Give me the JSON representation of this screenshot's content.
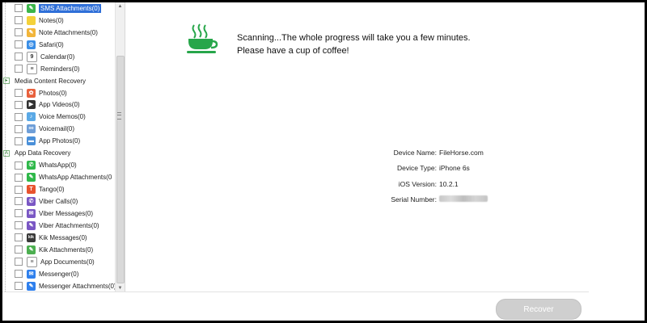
{
  "sidebar": {
    "rows": [
      {
        "type": "item",
        "label": "SMS Attachments(0)",
        "icon": "sms-attachment-icon",
        "color": "#3bb54a",
        "glyph": "✎",
        "selected": true
      },
      {
        "type": "item",
        "label": "Notes(0)",
        "icon": "notes-icon",
        "color": "#f4d13a",
        "glyph": ""
      },
      {
        "type": "item",
        "label": "Note Attachments(0)",
        "icon": "note-attachment-icon",
        "color": "#f2b53a",
        "glyph": "✎"
      },
      {
        "type": "item",
        "label": "Safari(0)",
        "icon": "safari-icon",
        "color": "#3a8ee6",
        "glyph": "◎"
      },
      {
        "type": "item",
        "label": "Calendar(0)",
        "icon": "calendar-icon",
        "color": "#ffffff",
        "glyph": "9",
        "fg": "#333",
        "border": "#999"
      },
      {
        "type": "item",
        "label": "Reminders(0)",
        "icon": "reminders-icon",
        "color": "#ffffff",
        "glyph": "≡",
        "fg": "#333",
        "border": "#999"
      },
      {
        "type": "group",
        "label": "Media Content Recovery",
        "icon": "media-expander-icon"
      },
      {
        "type": "item",
        "label": "Photos(0)",
        "icon": "photos-icon",
        "color": "#e8603c",
        "glyph": "✿"
      },
      {
        "type": "item",
        "label": "App Videos(0)",
        "icon": "video-icon",
        "color": "#333333",
        "glyph": "▶"
      },
      {
        "type": "item",
        "label": "Voice Memos(0)",
        "icon": "voice-memo-icon",
        "color": "#5aa9e6",
        "glyph": "♪"
      },
      {
        "type": "item",
        "label": "Voicemail(0)",
        "icon": "voicemail-icon",
        "color": "#6f9fd8",
        "glyph": "oo"
      },
      {
        "type": "item",
        "label": "App Photos(0)",
        "icon": "app-photos-icon",
        "color": "#4a90d9",
        "glyph": "▬"
      },
      {
        "type": "group",
        "label": "App Data Recovery",
        "icon": "app-data-expander-icon"
      },
      {
        "type": "item",
        "label": "WhatsApp(0)",
        "icon": "whatsapp-icon",
        "color": "#2fb84a",
        "glyph": "✆"
      },
      {
        "type": "item",
        "label": "WhatsApp Attachments(0",
        "icon": "whatsapp-attachment-icon",
        "color": "#2fb84a",
        "glyph": "✎"
      },
      {
        "type": "item",
        "label": "Tango(0)",
        "icon": "tango-icon",
        "color": "#e8532e",
        "glyph": "T"
      },
      {
        "type": "item",
        "label": "Viber Calls(0)",
        "icon": "viber-icon",
        "color": "#7a57c4",
        "glyph": "✆"
      },
      {
        "type": "item",
        "label": "Viber Messages(0)",
        "icon": "viber-message-icon",
        "color": "#7a57c4",
        "glyph": "✉"
      },
      {
        "type": "item",
        "label": "Viber Attachments(0)",
        "icon": "viber-attachment-icon",
        "color": "#7a57c4",
        "glyph": "✎"
      },
      {
        "type": "item",
        "label": "Kik Messages(0)",
        "icon": "kik-icon",
        "color": "#3a3a3a",
        "glyph": "kik"
      },
      {
        "type": "item",
        "label": "Kik Attachments(0)",
        "icon": "kik-attachment-icon",
        "color": "#4caf50",
        "glyph": "✎"
      },
      {
        "type": "item",
        "label": "App Documents(0)",
        "icon": "document-icon",
        "color": "#ffffff",
        "glyph": "≡",
        "fg": "#555",
        "border": "#999"
      },
      {
        "type": "item",
        "label": "Messenger(0)",
        "icon": "messenger-icon",
        "color": "#2f80ed",
        "glyph": "✉"
      },
      {
        "type": "item",
        "label": "Messenger Attachments(0)",
        "icon": "messenger-attachment-icon",
        "color": "#2f80ed",
        "glyph": "✎"
      }
    ]
  },
  "main": {
    "icon": "coffee-cup-icon",
    "accent": "#27a64a",
    "scan_line1": "Scanning...The whole progress will take you a few minutes.",
    "scan_line2": "Please have a cup of coffee!",
    "device": {
      "name_label": "Device Name:",
      "name_value": "FileHorse.com",
      "type_label": "Device Type:",
      "type_value": "iPhone 6s",
      "ios_label": "iOS Version:",
      "ios_value": "10.2.1",
      "serial_label": "Serial Number:"
    }
  },
  "footer": {
    "recover_label": "Recover"
  }
}
